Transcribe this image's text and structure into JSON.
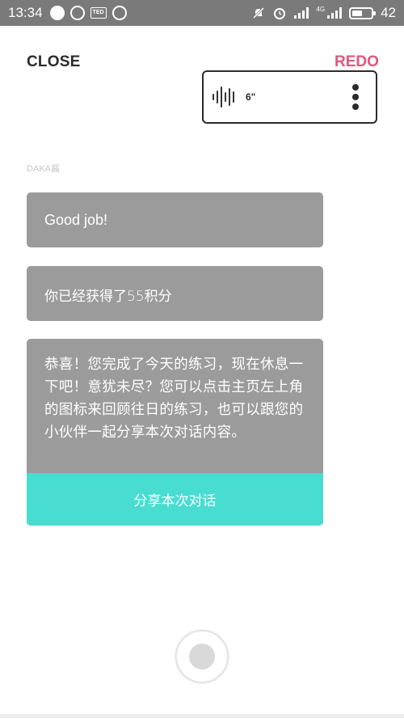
{
  "status_bar": {
    "time": "13:34",
    "network_label": "4G",
    "battery": "42"
  },
  "header": {
    "close_label": "CLOSE",
    "redo_label": "REDO"
  },
  "voice_message": {
    "duration": "6\""
  },
  "conversation": {
    "speaker": "DAKA酱",
    "messages": [
      "Good job!",
      "你已经获得了55积分",
      "恭喜！您完成了今天的练习，现在休息一下吧！意犹未尽？您可以点击主页左上角的图标来回顾往日的练习，也可以跟您的小伙伴一起分享本次对话内容。"
    ],
    "share_label": "分享本次对话"
  },
  "colors": {
    "accent_teal": "#48ddd0",
    "redo_pink": "#e2557a",
    "bubble_gray": "#9b9b9b"
  }
}
